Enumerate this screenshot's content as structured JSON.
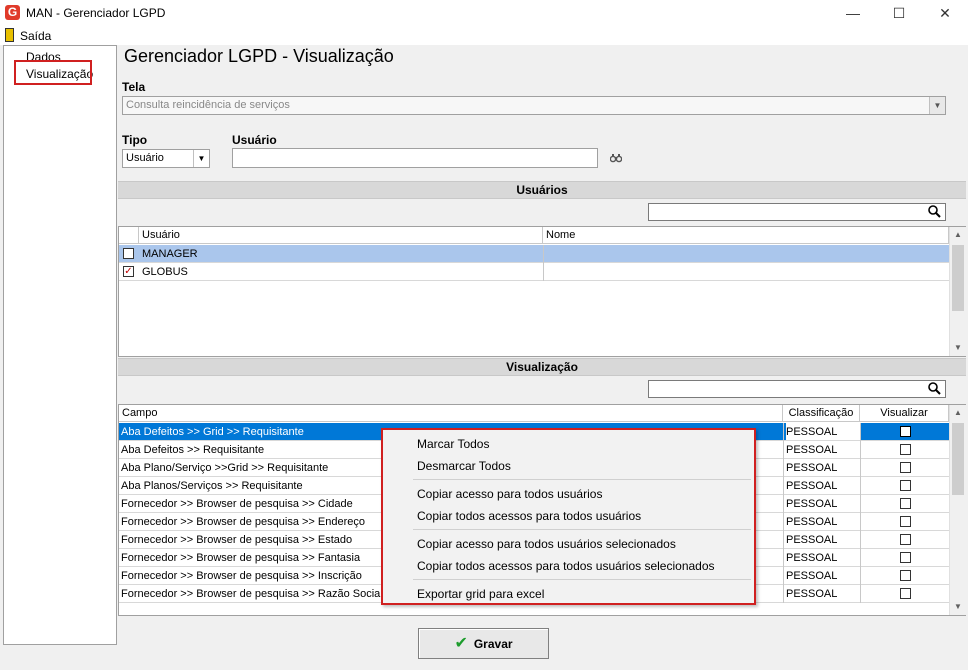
{
  "window": {
    "app_icon": "G",
    "title": "MAN - Gerenciador LGPD",
    "minimize": "—",
    "maximize": "☐",
    "close": "✕"
  },
  "menu": {
    "exit_label": "Saída",
    "exit_icon": "door-exit-icon"
  },
  "tree": {
    "items": [
      "Dados",
      "Visualização"
    ],
    "selected": "Visualização"
  },
  "page_title": "Gerenciador LGPD - Visualização",
  "tela": {
    "label": "Tela",
    "value": "Consulta reincidência de serviços"
  },
  "tipo": {
    "label": "Tipo",
    "value": "Usuário"
  },
  "usuario": {
    "label": "Usuário",
    "value": ""
  },
  "users_section": {
    "title": "Usuários",
    "columns": [
      "Usuário",
      "Nome"
    ],
    "rows": [
      {
        "checked": false,
        "usuario": "MANAGER",
        "nome": "",
        "highlight": true
      },
      {
        "checked": true,
        "usuario": "GLOBUS",
        "nome": "",
        "highlight": false
      }
    ]
  },
  "vis_section": {
    "title": "Visualização",
    "columns": [
      "Campo",
      "Classificação",
      "Visualizar"
    ],
    "rows": [
      {
        "campo": "Aba Defeitos >> Grid >> Requisitante",
        "classificacao": "PESSOAL",
        "visualizar": false
      },
      {
        "campo": "Aba Defeitos >> Requisitante",
        "classificacao": "PESSOAL",
        "visualizar": false
      },
      {
        "campo": "Aba Plano/Serviço >>Grid >> Requisitante",
        "classificacao": "PESSOAL",
        "visualizar": false
      },
      {
        "campo": "Aba Planos/Serviços >> Requisitante",
        "classificacao": "PESSOAL",
        "visualizar": false
      },
      {
        "campo": "Fornecedor >> Browser de pesquisa >> Cidade",
        "classificacao": "PESSOAL",
        "visualizar": false
      },
      {
        "campo": "Fornecedor >> Browser de pesquisa >> Endereço",
        "classificacao": "PESSOAL",
        "visualizar": false
      },
      {
        "campo": "Fornecedor >> Browser de pesquisa >> Estado",
        "classificacao": "PESSOAL",
        "visualizar": false
      },
      {
        "campo": "Fornecedor >> Browser de pesquisa >> Fantasia",
        "classificacao": "PESSOAL",
        "visualizar": false
      },
      {
        "campo": "Fornecedor >> Browser de pesquisa >> Inscrição",
        "classificacao": "PESSOAL",
        "visualizar": false
      },
      {
        "campo": "Fornecedor >> Browser de pesquisa >> Razão Social",
        "classificacao": "PESSOAL",
        "visualizar": false
      }
    ]
  },
  "context_menu": {
    "items": [
      "Marcar Todos",
      "Desmarcar Todos",
      "Copiar acesso para todos usuários",
      "Copiar todos acessos para todos usuários",
      "Copiar acesso para todos usuários selecionados",
      "Copiar todos acessos para todos usuários selecionados",
      "Exportar grid para excel"
    ]
  },
  "gravar": {
    "label": "Gravar",
    "icon": "green-check-icon"
  },
  "colors": {
    "selection": "#0078d7",
    "row_highlight": "#aac6ec",
    "context_border": "#d02020",
    "gravar_check": "#1c9c2c"
  }
}
